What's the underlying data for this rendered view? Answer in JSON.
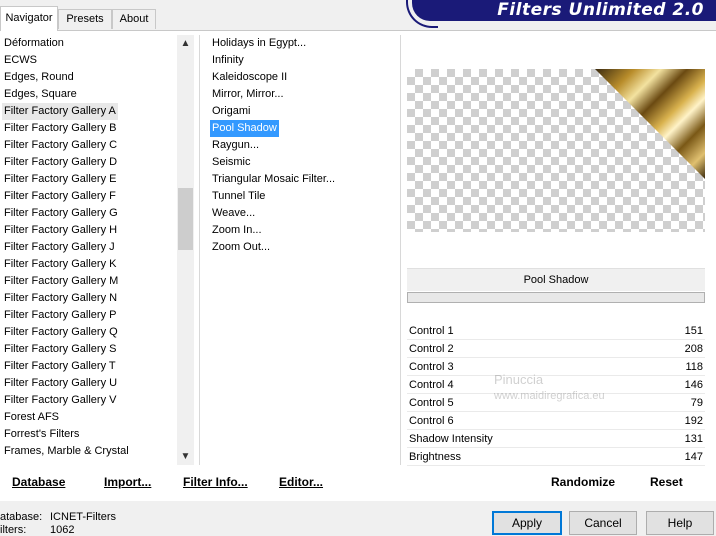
{
  "tabs": [
    "Navigator",
    "Presets",
    "About"
  ],
  "banner_title": "Filters Unlimited 2.0",
  "categories": [
    "Déformation",
    "ECWS",
    "Edges, Round",
    "Edges, Square",
    "Filter Factory Gallery A",
    "Filter Factory Gallery B",
    "Filter Factory Gallery C",
    "Filter Factory Gallery D",
    "Filter Factory Gallery E",
    "Filter Factory Gallery F",
    "Filter Factory Gallery G",
    "Filter Factory Gallery H",
    "Filter Factory Gallery J",
    "Filter Factory Gallery K",
    "Filter Factory Gallery M",
    "Filter Factory Gallery N",
    "Filter Factory Gallery P",
    "Filter Factory Gallery Q",
    "Filter Factory Gallery S",
    "Filter Factory Gallery T",
    "Filter Factory Gallery U",
    "Filter Factory Gallery V",
    "Forest AFS",
    "Forrest's Filters",
    "Frames, Marble & Crystal"
  ],
  "selected_category": "Filter Factory Gallery A",
  "filters": [
    "Holidays in Egypt...",
    "Infinity",
    "Kaleidoscope II",
    "Mirror, Mirror...",
    "Origami",
    "Pool Shadow",
    "Raygun...",
    "Seismic",
    "Triangular Mosaic Filter...",
    "Tunnel Tile",
    "Weave...",
    "Zoom In...",
    "Zoom Out..."
  ],
  "selected_filter": "Pool Shadow",
  "filter_name": "Pool Shadow",
  "controls": [
    {
      "label": "Control 1",
      "value": "151"
    },
    {
      "label": "Control 2",
      "value": "208"
    },
    {
      "label": "Control 3",
      "value": "118"
    },
    {
      "label": "Control 4",
      "value": "146"
    },
    {
      "label": "Control 5",
      "value": "79"
    },
    {
      "label": "Control 6",
      "value": "192"
    },
    {
      "label": "Shadow Intensity",
      "value": "131"
    },
    {
      "label": "Brightness",
      "value": "147"
    }
  ],
  "watermark": {
    "line1": "Pinuccia",
    "line2": "www.maidiregrafica.eu"
  },
  "toolbar": {
    "database": "Database",
    "import": "Import...",
    "filter_info": "Filter Info...",
    "editor": "Editor...",
    "randomize": "Randomize",
    "reset": "Reset"
  },
  "status": {
    "database_label": "atabase:",
    "database_value": "ICNET-Filters",
    "filters_label": "ilters:",
    "filters_value": "1062"
  },
  "buttons": {
    "apply": "Apply",
    "cancel": "Cancel",
    "help": "Help"
  }
}
